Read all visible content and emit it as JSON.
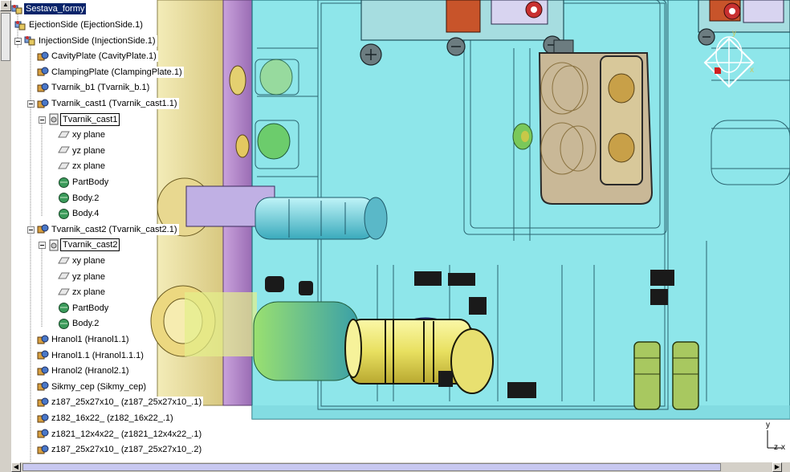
{
  "tree": {
    "root": {
      "label": "Sestava_formy",
      "icon": "product-icon"
    },
    "items": [
      {
        "label": "EjectionSide (EjectionSide.1)",
        "icon": "product-icon"
      },
      {
        "label": "InjectionSide (InjectionSide.1)",
        "icon": "product-icon"
      },
      {
        "label": "CavityPlate (CavityPlate.1)",
        "icon": "part-icon"
      },
      {
        "label": "ClampingPlate (ClampingPlate.1)",
        "icon": "part-icon"
      },
      {
        "label": "Tvarnik_b1 (Tvarnik_b.1)",
        "icon": "part-icon"
      },
      {
        "label": "Tvarnik_cast1 (Tvarnik_cast1.1)",
        "icon": "part-icon"
      },
      {
        "label": "Tvarnik_cast1",
        "icon": "part-doc-icon"
      },
      {
        "label": "xy plane",
        "icon": "plane-icon"
      },
      {
        "label": "yz plane",
        "icon": "plane-icon"
      },
      {
        "label": "zx plane",
        "icon": "plane-icon"
      },
      {
        "label": "PartBody",
        "icon": "body-icon"
      },
      {
        "label": "Body.2",
        "icon": "body-icon"
      },
      {
        "label": "Body.4",
        "icon": "body-icon"
      },
      {
        "label": "Tvarnik_cast2 (Tvarnik_cast2.1)",
        "icon": "part-icon"
      },
      {
        "label": "Tvarnik_cast2",
        "icon": "part-doc-icon"
      },
      {
        "label": "xy plane",
        "icon": "plane-icon"
      },
      {
        "label": "yz plane",
        "icon": "plane-icon"
      },
      {
        "label": "zx plane",
        "icon": "plane-icon"
      },
      {
        "label": "PartBody",
        "icon": "body-icon"
      },
      {
        "label": "Body.2",
        "icon": "body-icon"
      },
      {
        "label": "Hranol1 (Hranol1.1)",
        "icon": "part-icon"
      },
      {
        "label": "Hranol1.1 (Hranol1.1.1)",
        "icon": "part-icon"
      },
      {
        "label": "Hranol2 (Hranol2.1)",
        "icon": "part-icon"
      },
      {
        "label": "Sikmy_cep (Sikmy_cep)",
        "icon": "part-icon"
      },
      {
        "label": "z187_25x27x10_ (z187_25x27x10_.1)",
        "icon": "part-icon"
      },
      {
        "label": "z182_16x22_ (z182_16x22_.1)",
        "icon": "part-icon"
      },
      {
        "label": "z1821_12x4x22_ (z1821_12x4x22_.1)",
        "icon": "part-icon"
      },
      {
        "label": "z187_25x27x10_ (z187_25x27x10_.2)",
        "icon": "part-icon"
      }
    ]
  },
  "compass_labels": {
    "x": "x",
    "y": "y"
  },
  "axis": {
    "x": "x",
    "y": "y",
    "z": "z"
  },
  "colors": {
    "background": "#ffffff",
    "mold_cyan": "#7fe0e4",
    "mold_edge": "#1f6f7a",
    "plate_yellow": "#e8e0a0",
    "plate_purple": "#b48ac8",
    "pin_yellow": "#f0ec70",
    "selection": "#0a246a",
    "scrollbar": "#d4d0c8"
  }
}
